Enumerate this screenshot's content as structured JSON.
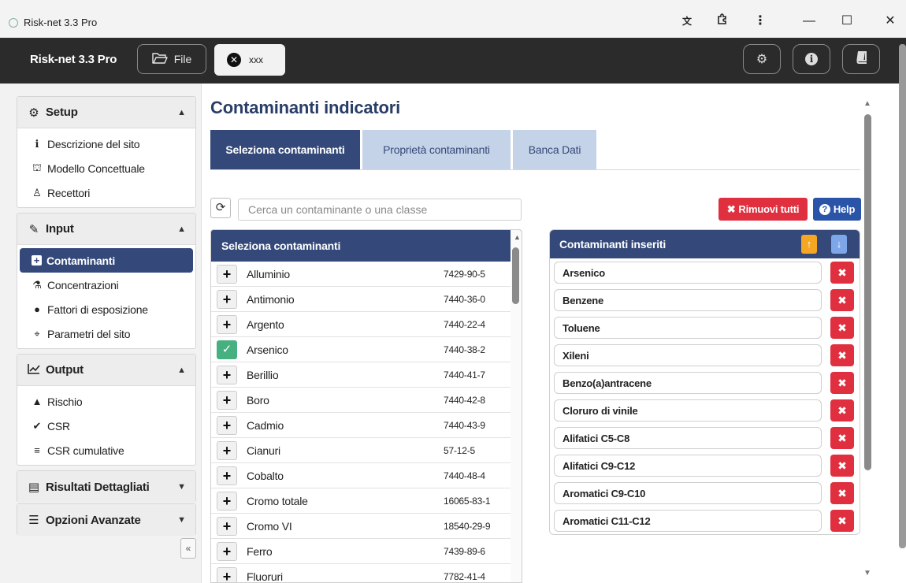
{
  "window": {
    "title": "Risk-net 3.3 Pro",
    "controls": {
      "translate_icon": "translate-icon",
      "extensions_icon": "puzzle-icon",
      "menu": "⋮",
      "minimize": "—",
      "maximize": "☐",
      "close": "✕"
    }
  },
  "header": {
    "brand": "Risk-net 3.3 Pro",
    "file_label": "File",
    "open_tab_label": "xxx",
    "right_icons": [
      "gear-icon",
      "info-icon",
      "book-icon"
    ]
  },
  "sidebar": {
    "setup": {
      "title": "Setup",
      "items": [
        "Descrizione del sito",
        "Modello Concettuale",
        "Recettori"
      ]
    },
    "input": {
      "title": "Input",
      "items": [
        "Contaminanti",
        "Concentrazioni",
        "Fattori di esposizione",
        "Parametri del sito"
      ],
      "active": "Contaminanti"
    },
    "output": {
      "title": "Output",
      "items": [
        "Rischio",
        "CSR",
        "CSR cumulative"
      ]
    },
    "risultati": {
      "title": "Risultati Dettagliati"
    },
    "opzioni": {
      "title": "Opzioni Avanzate"
    },
    "collapse_label": "«"
  },
  "main": {
    "title": "Contaminanti indicatori",
    "tabs": [
      "Seleziona contaminanti",
      "Proprietà contaminanti",
      "Banca Dati"
    ],
    "active_tab": "Seleziona contaminanti",
    "search_placeholder": "Cerca un contaminante o una classe",
    "remove_all_label": "Rimuovi tutti",
    "help_label": "Help",
    "list_header": "Seleziona contaminanti",
    "contaminants": [
      {
        "name": "Alluminio",
        "cas": "7429-90-5",
        "selected": false
      },
      {
        "name": "Antimonio",
        "cas": "7440-36-0",
        "selected": false
      },
      {
        "name": "Argento",
        "cas": "7440-22-4",
        "selected": false
      },
      {
        "name": "Arsenico",
        "cas": "7440-38-2",
        "selected": true
      },
      {
        "name": "Berillio",
        "cas": "7440-41-7",
        "selected": false
      },
      {
        "name": "Boro",
        "cas": "7440-42-8",
        "selected": false
      },
      {
        "name": "Cadmio",
        "cas": "7440-43-9",
        "selected": false
      },
      {
        "name": "Cianuri",
        "cas": "57-12-5",
        "selected": false
      },
      {
        "name": "Cobalto",
        "cas": "7440-48-4",
        "selected": false
      },
      {
        "name": "Cromo totale",
        "cas": "16065-83-1",
        "selected": false
      },
      {
        "name": "Cromo VI",
        "cas": "18540-29-9",
        "selected": false
      },
      {
        "name": "Ferro",
        "cas": "7439-89-6",
        "selected": false
      },
      {
        "name": "Fluoruri",
        "cas": "7782-41-4",
        "selected": false
      }
    ],
    "selected_header": "Contaminanti inseriti",
    "selected": [
      "Arsenico",
      "Benzene",
      "Toluene",
      "Xileni",
      "Benzo(a)antracene",
      "Cloruro di vinile",
      "Alifatici C5-C8",
      "Alifatici C9-C12",
      "Aromatici C9-C10",
      "Aromatici C11-C12"
    ]
  },
  "colors": {
    "primary": "#34497a",
    "tab_inactive": "#c5d3e8",
    "danger": "#e03040",
    "help": "#2a54a8",
    "success": "#46b080",
    "arrow_up": "#f5a623",
    "arrow_down": "#7da7e8"
  }
}
